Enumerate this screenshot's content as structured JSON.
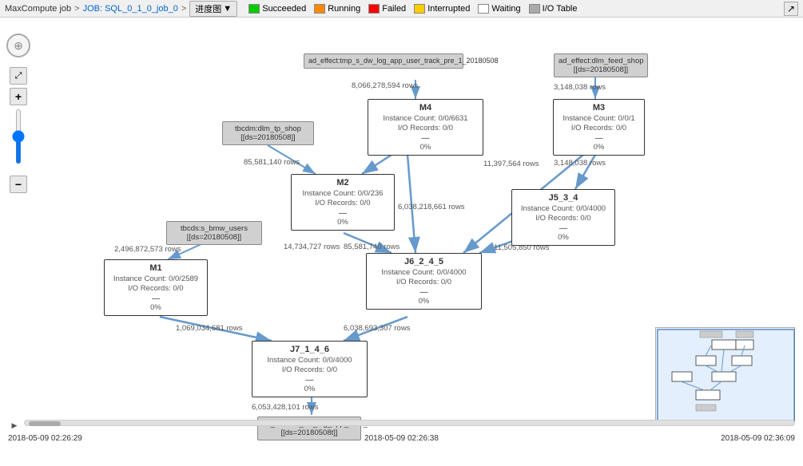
{
  "header": {
    "app_name": "MaxCompute job",
    "separator1": ">",
    "job_id": "JOB: SQL_0_1_0_job_0",
    "separator2": ">",
    "view_label": "进度图",
    "dropdown_icon": "▼"
  },
  "legend": {
    "items": [
      {
        "key": "succeeded",
        "label": "Succeeded",
        "color": "#00cc00"
      },
      {
        "key": "running",
        "label": "Running",
        "color": "#ff8800"
      },
      {
        "key": "failed",
        "label": "Failed",
        "color": "#ff0000"
      },
      {
        "key": "interrupted",
        "label": "Interrupted",
        "color": "#ffcc00"
      },
      {
        "key": "waiting",
        "label": "Waiting",
        "color": "#ffffff"
      },
      {
        "key": "io_table",
        "label": "I/O Table",
        "color": "#aaaaaa"
      }
    ]
  },
  "toolbar": {
    "compass_label": "⊕",
    "fit_label": "⤢",
    "zoom_in": "+",
    "zoom_out": "−",
    "zoom_value": 50
  },
  "nodes": {
    "m4": {
      "title": "M4",
      "instance": "Instance Count: 0/0/6631",
      "io": "I/O Records: 0/0",
      "dash": "—",
      "pct": "0%"
    },
    "m3": {
      "title": "M3",
      "instance": "Instance Count: 0/0/1",
      "io": "I/O Records: 0/0",
      "dash": "—",
      "pct": "0%"
    },
    "m2": {
      "title": "M2",
      "instance": "Instance Count: 0/0/236",
      "io": "I/O Records: 0/0",
      "dash": "—",
      "pct": "0%"
    },
    "j5_3_4": {
      "title": "J5_3_4",
      "instance": "Instance Count: 0/0/4000",
      "io": "I/O Records: 0/0",
      "dash": "—",
      "pct": "0%"
    },
    "m1": {
      "title": "M1",
      "instance": "Instance Count: 0/0/2589",
      "io": "I/O Records: 0/0",
      "dash": "—",
      "pct": "0%"
    },
    "j6_2_4_5": {
      "title": "J6_2_4_5",
      "instance": "Instance Count: 0/0/4000",
      "io": "I/O Records: 0/0",
      "dash": "—",
      "pct": "0%"
    },
    "j7_1_4_6": {
      "title": "J7_1_4_6",
      "instance": "Instance Count: 0/0/4000",
      "io": "I/O Records: 0/0",
      "dash": "—",
      "pct": "0%"
    }
  },
  "datasources": {
    "ad_effect_tmp": {
      "line1": "ad_effect:tmp_s_dw_log_app_user_track_pre_1_20180508"
    },
    "ad_effect_dlm": {
      "line1": "ad_effect:dlm_feed_shop",
      "line2": "[[ds=20180508]]"
    },
    "tbcdm_dlm": {
      "line1": "tbcdm:dlm_tp_shop",
      "line2": "[[ds=20180508]]"
    },
    "tbcds_s_bmw": {
      "line1": "tbcds:s_bmw_users",
      "line2": "[[ds=20180508]]"
    },
    "ad_effect_dw": {
      "line1": "ad_effect:s_dw_log_app_user_track",
      "line2": "[[ds=20180508t]]"
    }
  },
  "row_labels": {
    "r1": "8,066,278,594 rows",
    "r2": "3,148,038 rows",
    "r3": "85,581,140 rows",
    "r4": "3,148,038 rows",
    "r5": "6,038,218,661 rows",
    "r6": "11,397,564 rows",
    "r7": "2,496,872,573 rows",
    "r8": "14,734,727 rows",
    "r9": "85,581,740 rows",
    "r10": "11,505,850 rows",
    "r11": "1,069,034,681 rows",
    "r12": "6,038,693,307 rows",
    "r13": "6,053,428,101 rows"
  },
  "timestamps": {
    "t1": "2018-05-09 02:26:29",
    "t2": "2018-05-09 02:26:38",
    "t3": "2018-05-09 02:36:09"
  }
}
